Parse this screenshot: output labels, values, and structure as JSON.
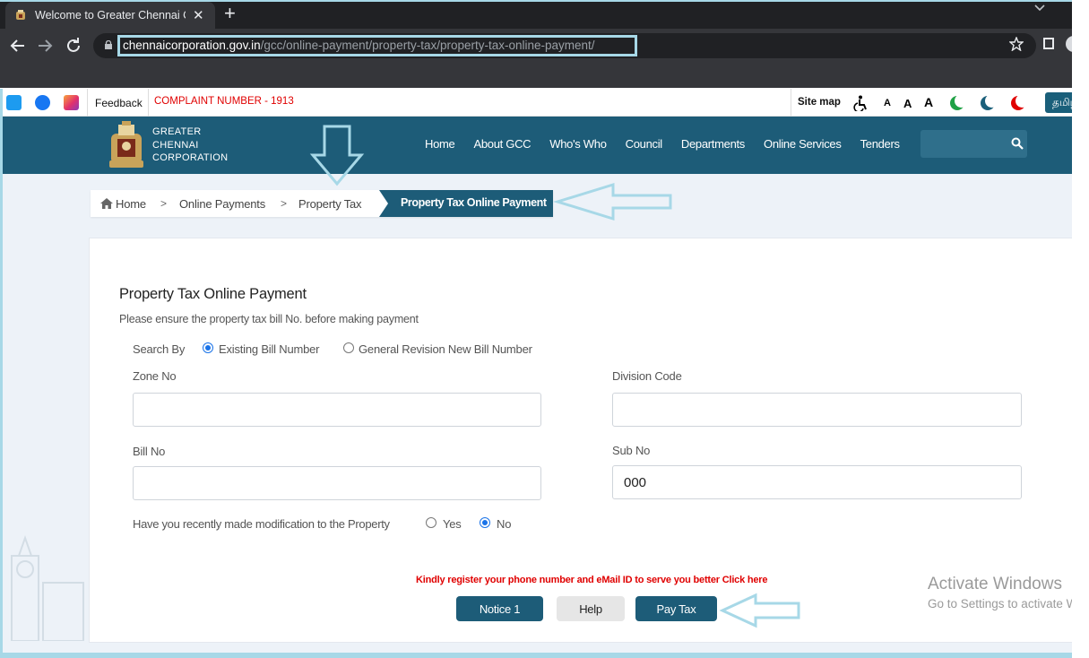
{
  "browser": {
    "tab_title": "Welcome to Greater Chennai Co",
    "new_tab_label": "+",
    "tab_close_label": "✕",
    "url_domain": "chennaicorporation.gov.in",
    "url_path": "/gcc/online-payment/property-tax/property-tax-online-payment/",
    "icons": [
      "back-icon",
      "forward-icon",
      "reload-icon",
      "lock-icon",
      "star-icon",
      "chevron-down-icon"
    ]
  },
  "utility": {
    "feedback": "Feedback",
    "complaint": "COMPLAINT NUMBER - 1913",
    "sitemap": "Site map",
    "font_sizes": [
      "A",
      "A",
      "A"
    ],
    "language": "தமிழ்"
  },
  "header": {
    "logo_lines": [
      "GREATER",
      "CHENNAI",
      "CORPORATION"
    ],
    "nav": [
      "Home",
      "About GCC",
      "Who's Who",
      "Council",
      "Departments",
      "Online Services",
      "Tenders"
    ],
    "color": "#1d5c78"
  },
  "breadcrumb": {
    "home": "Home",
    "sep": ">",
    "items": [
      "Online Payments",
      "Property Tax"
    ],
    "active": "Property Tax Online Payment"
  },
  "form": {
    "title": "Property Tax Online Payment",
    "subtitle": "Please ensure the property tax bill No. before making payment",
    "search_by_label": "Search By",
    "search_options": [
      "Existing Bill Number",
      "General Revision New Bill Number"
    ],
    "search_selected": "Existing Bill Number",
    "zone_label": "Zone No",
    "zone_value": "",
    "division_label": "Division Code",
    "division_value": "",
    "bill_label": "Bill No",
    "bill_value": "",
    "sub_label": "Sub No",
    "sub_value": "000",
    "modified_question": "Have you recently made modification to the Property",
    "modified_options": [
      "Yes",
      "No"
    ],
    "modified_selected": "No",
    "register_note": "Kindly register your phone number and eMail ID to serve you better Click here",
    "buttons": {
      "notice": "Notice 1",
      "help": "Help",
      "pay": "Pay Tax"
    }
  },
  "watermark": {
    "title": "Activate Windows",
    "subtitle": "Go to Settings to activate Windows."
  },
  "annotation_color": "#a7d8e7"
}
